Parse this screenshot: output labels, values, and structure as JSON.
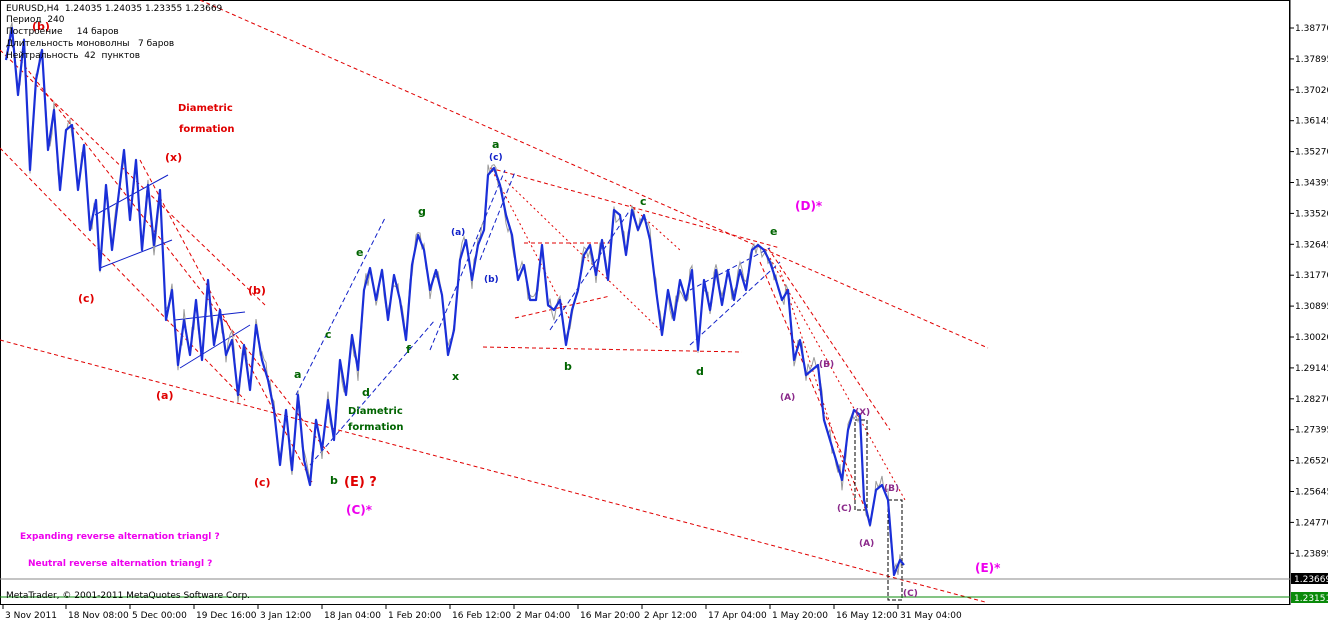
{
  "header": {
    "symbol_line": "EURUSD,H4  1.24035 1.24035 1.23355 1.23669",
    "period_line": "Период  240",
    "build_line": "Построение     14 баров",
    "mono_line": "Длительность моноволны   7 баров",
    "neutral_line": "Нейтральность  42  пунктов"
  },
  "copyright": "MetaTrader, © 2001-2011 MetaQuotes Software Corp.",
  "price_axis": {
    "ticks": [
      "1.38770",
      "1.37895",
      "1.37020",
      "1.36145",
      "1.35270",
      "1.34395",
      "1.33520",
      "1.32645",
      "1.31770",
      "1.30895",
      "1.30020",
      "1.29145",
      "1.28270",
      "1.27395",
      "1.26520",
      "1.25645",
      "1.24770",
      "1.23895"
    ],
    "current_price": "1.23669",
    "support_price": "1.23151"
  },
  "time_axis": {
    "ticks": [
      "3 Nov 2011",
      "18 Nov 08:00",
      "5 Dec 00:00",
      "19 Dec 16:00",
      "3 Jan 12:00",
      "18 Jan 04:00",
      "1 Feb 20:00",
      "16 Feb 12:00",
      "2 Mar 04:00",
      "16 Mar 20:00",
      "2 Apr 12:00",
      "17 Apr 04:00",
      "1 May 20:00",
      "16 May 12:00",
      "31 May 04:00"
    ]
  },
  "labels": {
    "diametric1_a": "Diametric",
    "diametric1_b": "formation",
    "diametric2_a": "Diametric",
    "diametric2_b": "formation",
    "expanding": "Expanding reverse alternation triangl  ?",
    "neutral": "Neutral reverse alternation triangl ?",
    "b_top": "(b)",
    "x_paren": "(x)",
    "c_left": "(c)",
    "b_mid": "(b)",
    "a_left": "(a)",
    "c_bottom": "(c)",
    "E_q": "(E) ?",
    "C_star": "(C)*",
    "D_star": "(D)*",
    "E_star": "(E)*",
    "g": "g",
    "e1": "e",
    "c_green": "c",
    "a_green": "a",
    "d_green": "d",
    "b_green": "b",
    "f_green": "f",
    "x_green": "x",
    "a_top": "a",
    "c_top": "(c)",
    "a_blue": "(a)",
    "b_blue": "(b)",
    "b_green2": "b",
    "c_green2": "c",
    "d_green2": "d",
    "e_green2": "e",
    "B_purple": "(B)",
    "A_purple": "(A)",
    "X_purple": "(X)",
    "C_purple": "(C)",
    "B2_purple": "(B)",
    "A2_purple": "(A)",
    "C2_purple": "(C)"
  },
  "colors": {
    "red": "#e00000",
    "green": "#006400",
    "magenta": "#ee00ee",
    "blue": "#1020c8",
    "purple": "#8b2a8b"
  }
}
